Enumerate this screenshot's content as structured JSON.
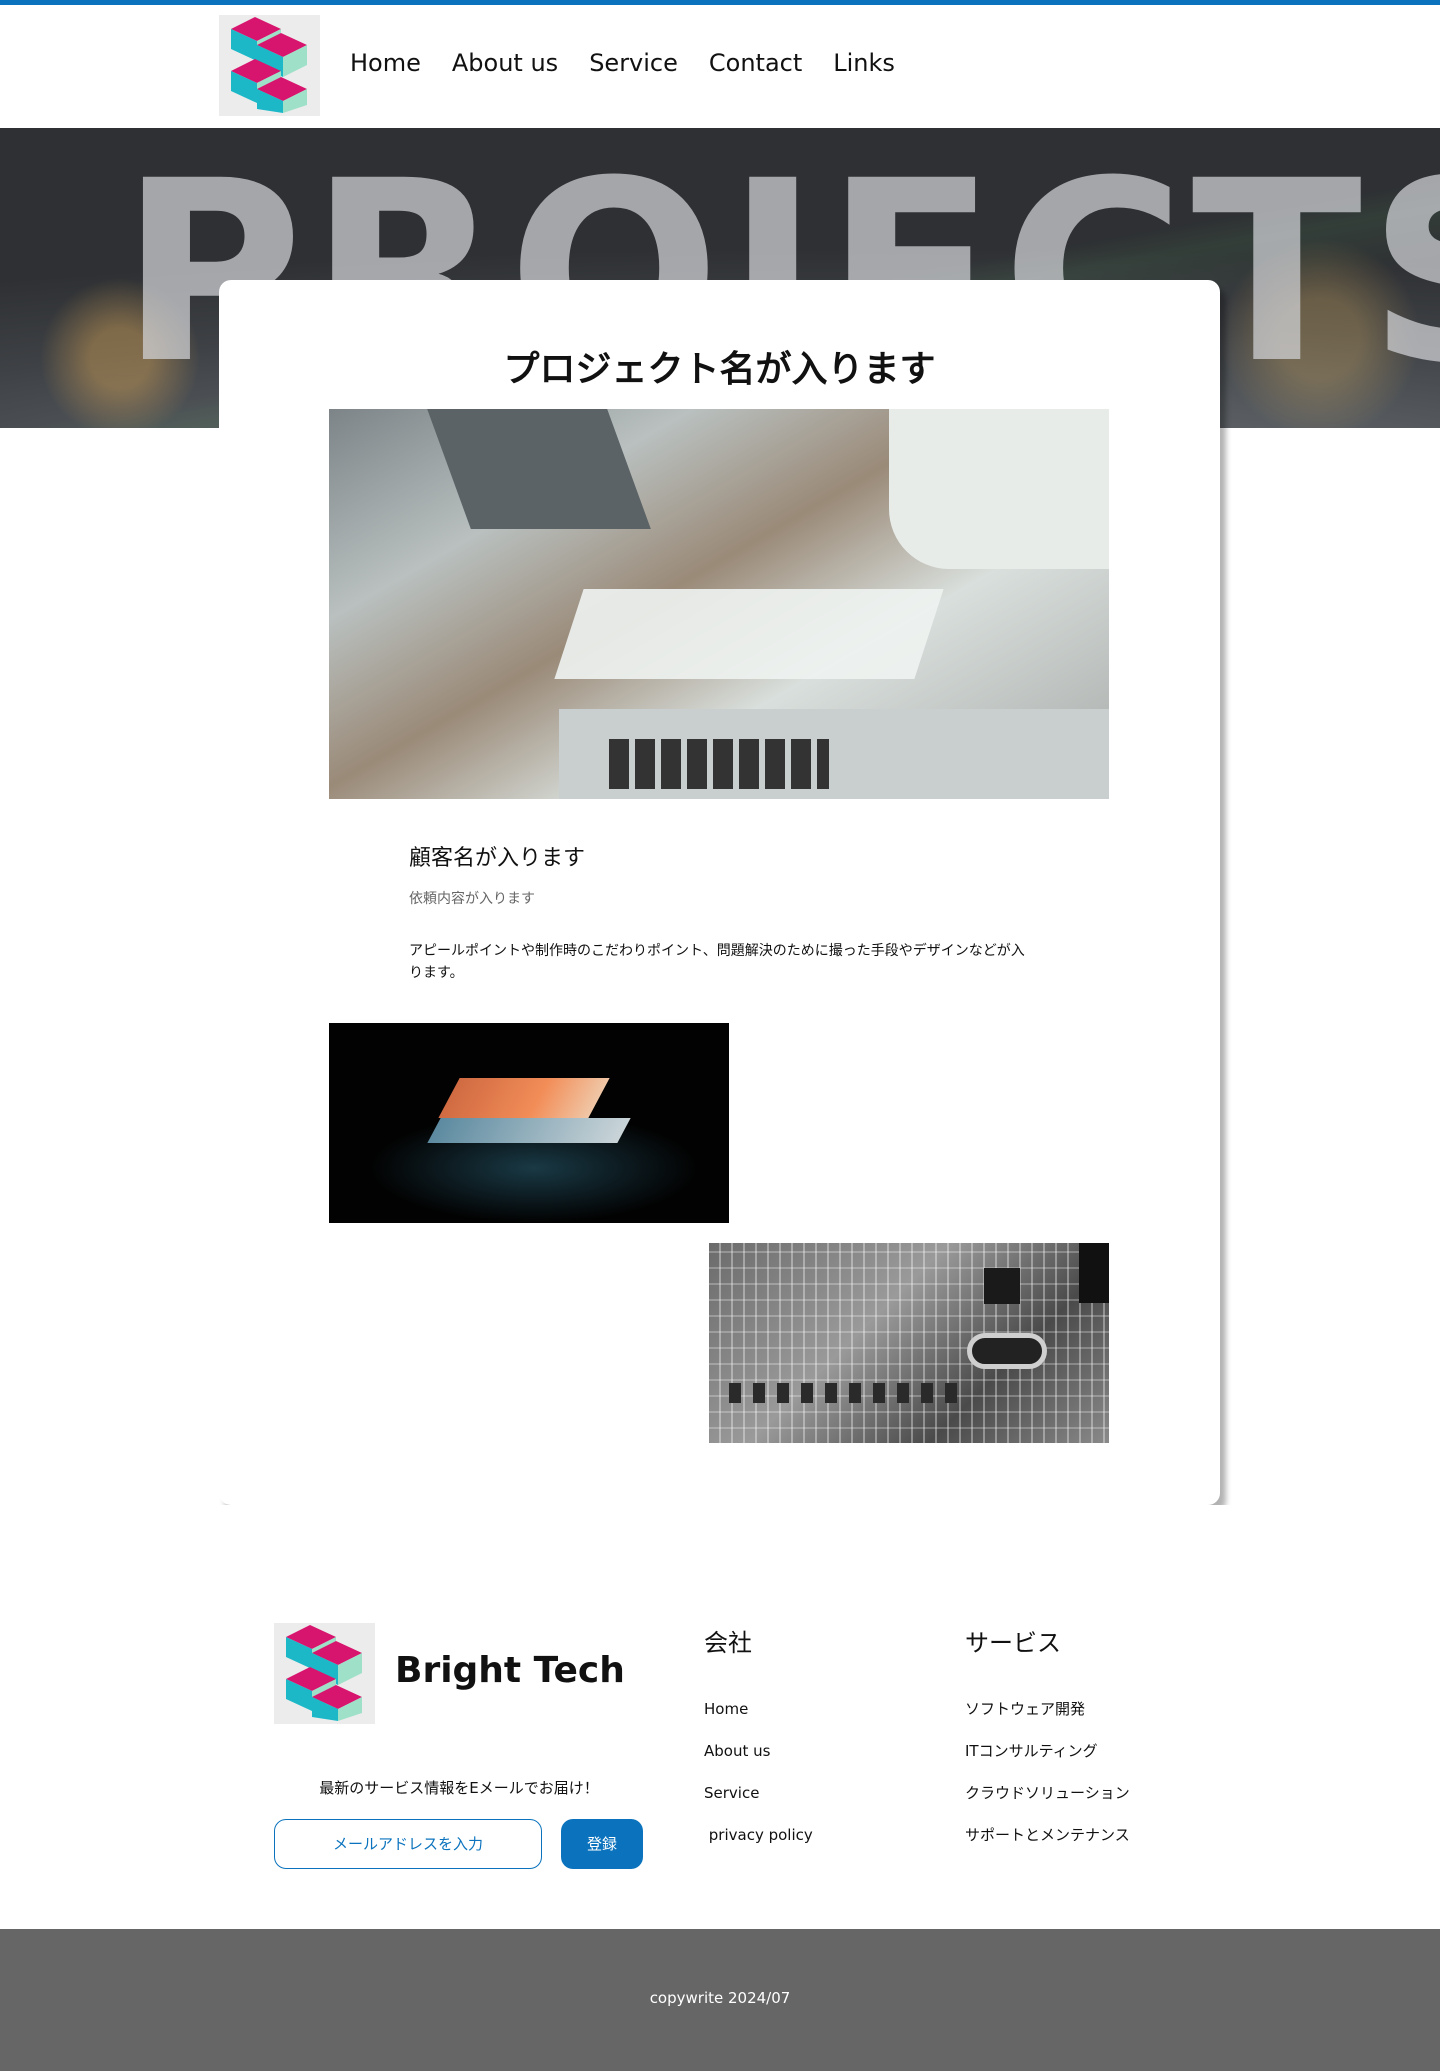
{
  "colors": {
    "accent": "#0b73bd",
    "footer_bg": "#666666",
    "logo_magenta": "#d8156e",
    "logo_teal": "#1cb8c8",
    "logo_mint": "#9fe0c8"
  },
  "header": {
    "logo_icon": "bright-tech-cube-logo",
    "nav": [
      "Home",
      "About us",
      "Service",
      "Contact",
      "Links"
    ]
  },
  "hero": {
    "watermark": "PROJECTS"
  },
  "project": {
    "title": "プロジェクト名が入ります",
    "client": "顧客名が入ります",
    "request": "依頼内容が入ります",
    "description": "アピールポイントや制作時のこだわりポイント、問題解決のために撮った手段やデザインなどが入ります。"
  },
  "footer": {
    "brand": "Bright Tech",
    "newsletter_text": "最新のサービス情報をEメールでお届け！",
    "email_placeholder": "メールアドレスを入力",
    "subscribe_label": "登録",
    "company": {
      "heading": "会社",
      "links": [
        "Home",
        "About us",
        "Service",
        " privacy policy"
      ]
    },
    "services": {
      "heading": "サービス",
      "links": [
        "ソフトウェア開発",
        "ITコンサルティング",
        "クラウドソリューション",
        "サポートとメンテナンス"
      ]
    },
    "copyright": "copywrite 2024/07"
  }
}
